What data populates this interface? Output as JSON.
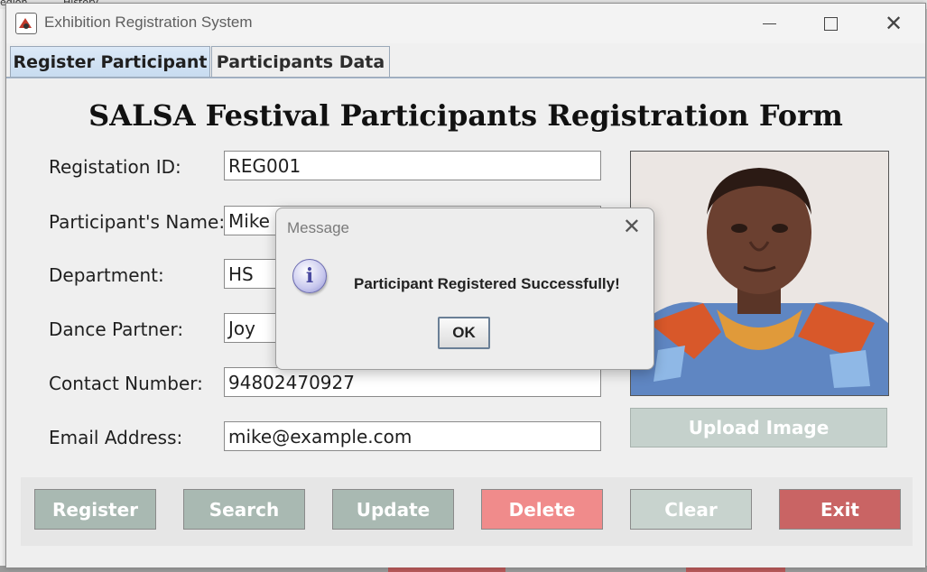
{
  "window": {
    "title": "Exhibition Registration System",
    "minimize_icon": "minimize-icon",
    "maximize_icon": "maximize-icon",
    "close_icon": "close-icon"
  },
  "background": {
    "top_text_1": "egion",
    "top_text_2": "History"
  },
  "tabs": [
    {
      "label": "Register Participant",
      "active": true
    },
    {
      "label": "Participants Data",
      "active": false
    }
  ],
  "form": {
    "title": "SALSA Festival Participants Registration Form",
    "fields": [
      {
        "label": "Registation ID:",
        "value": "REG001"
      },
      {
        "label": "Participant's Name:",
        "value": "Mike C"
      },
      {
        "label": "Department:",
        "value": "HS"
      },
      {
        "label": "Dance Partner:",
        "value": "Joy"
      },
      {
        "label": "Contact Number:",
        "value": "94802470927"
      },
      {
        "label": "Email Address:",
        "value": "mike@example.com"
      }
    ],
    "upload_label": "Upload Image"
  },
  "buttons": {
    "register": {
      "label": "Register",
      "color": "#a9b9b2"
    },
    "search": {
      "label": "Search",
      "color": "#a9b9b2"
    },
    "update": {
      "label": "Update",
      "color": "#a9b9b2"
    },
    "delete": {
      "label": "Delete",
      "color": "#f08b8b"
    },
    "clear": {
      "label": "Clear",
      "color": "#c8d3ce"
    },
    "exit": {
      "label": "Exit",
      "color": "#c96464"
    }
  },
  "dialog": {
    "title": "Message",
    "message": "Participant Registered Successfully!",
    "ok_label": "OK",
    "icon": "info-icon"
  },
  "colors": {
    "tab_active": "#c8dcf0",
    "window_bg": "#f0f0f0"
  }
}
